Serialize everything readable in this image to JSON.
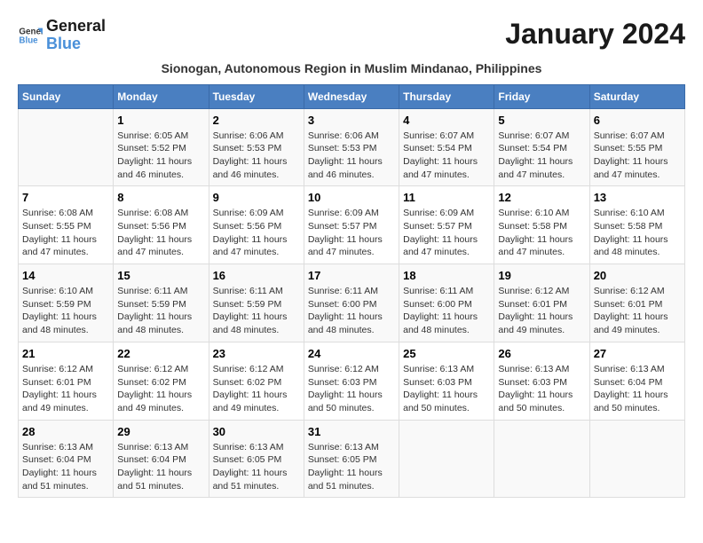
{
  "logo": {
    "line1": "General",
    "line2": "Blue"
  },
  "header": {
    "month": "January 2024",
    "subtitle": "Sionogan, Autonomous Region in Muslim Mindanao, Philippines"
  },
  "days_of_week": [
    "Sunday",
    "Monday",
    "Tuesday",
    "Wednesday",
    "Thursday",
    "Friday",
    "Saturday"
  ],
  "weeks": [
    [
      {
        "date": "",
        "info": ""
      },
      {
        "date": "1",
        "info": "Sunrise: 6:05 AM\nSunset: 5:52 PM\nDaylight: 11 hours\nand 46 minutes."
      },
      {
        "date": "2",
        "info": "Sunrise: 6:06 AM\nSunset: 5:53 PM\nDaylight: 11 hours\nand 46 minutes."
      },
      {
        "date": "3",
        "info": "Sunrise: 6:06 AM\nSunset: 5:53 PM\nDaylight: 11 hours\nand 46 minutes."
      },
      {
        "date": "4",
        "info": "Sunrise: 6:07 AM\nSunset: 5:54 PM\nDaylight: 11 hours\nand 47 minutes."
      },
      {
        "date": "5",
        "info": "Sunrise: 6:07 AM\nSunset: 5:54 PM\nDaylight: 11 hours\nand 47 minutes."
      },
      {
        "date": "6",
        "info": "Sunrise: 6:07 AM\nSunset: 5:55 PM\nDaylight: 11 hours\nand 47 minutes."
      }
    ],
    [
      {
        "date": "7",
        "info": "Sunrise: 6:08 AM\nSunset: 5:55 PM\nDaylight: 11 hours\nand 47 minutes."
      },
      {
        "date": "8",
        "info": "Sunrise: 6:08 AM\nSunset: 5:56 PM\nDaylight: 11 hours\nand 47 minutes."
      },
      {
        "date": "9",
        "info": "Sunrise: 6:09 AM\nSunset: 5:56 PM\nDaylight: 11 hours\nand 47 minutes."
      },
      {
        "date": "10",
        "info": "Sunrise: 6:09 AM\nSunset: 5:57 PM\nDaylight: 11 hours\nand 47 minutes."
      },
      {
        "date": "11",
        "info": "Sunrise: 6:09 AM\nSunset: 5:57 PM\nDaylight: 11 hours\nand 47 minutes."
      },
      {
        "date": "12",
        "info": "Sunrise: 6:10 AM\nSunset: 5:58 PM\nDaylight: 11 hours\nand 47 minutes."
      },
      {
        "date": "13",
        "info": "Sunrise: 6:10 AM\nSunset: 5:58 PM\nDaylight: 11 hours\nand 48 minutes."
      }
    ],
    [
      {
        "date": "14",
        "info": "Sunrise: 6:10 AM\nSunset: 5:59 PM\nDaylight: 11 hours\nand 48 minutes."
      },
      {
        "date": "15",
        "info": "Sunrise: 6:11 AM\nSunset: 5:59 PM\nDaylight: 11 hours\nand 48 minutes."
      },
      {
        "date": "16",
        "info": "Sunrise: 6:11 AM\nSunset: 5:59 PM\nDaylight: 11 hours\nand 48 minutes."
      },
      {
        "date": "17",
        "info": "Sunrise: 6:11 AM\nSunset: 6:00 PM\nDaylight: 11 hours\nand 48 minutes."
      },
      {
        "date": "18",
        "info": "Sunrise: 6:11 AM\nSunset: 6:00 PM\nDaylight: 11 hours\nand 48 minutes."
      },
      {
        "date": "19",
        "info": "Sunrise: 6:12 AM\nSunset: 6:01 PM\nDaylight: 11 hours\nand 49 minutes."
      },
      {
        "date": "20",
        "info": "Sunrise: 6:12 AM\nSunset: 6:01 PM\nDaylight: 11 hours\nand 49 minutes."
      }
    ],
    [
      {
        "date": "21",
        "info": "Sunrise: 6:12 AM\nSunset: 6:01 PM\nDaylight: 11 hours\nand 49 minutes."
      },
      {
        "date": "22",
        "info": "Sunrise: 6:12 AM\nSunset: 6:02 PM\nDaylight: 11 hours\nand 49 minutes."
      },
      {
        "date": "23",
        "info": "Sunrise: 6:12 AM\nSunset: 6:02 PM\nDaylight: 11 hours\nand 49 minutes."
      },
      {
        "date": "24",
        "info": "Sunrise: 6:12 AM\nSunset: 6:03 PM\nDaylight: 11 hours\nand 50 minutes."
      },
      {
        "date": "25",
        "info": "Sunrise: 6:13 AM\nSunset: 6:03 PM\nDaylight: 11 hours\nand 50 minutes."
      },
      {
        "date": "26",
        "info": "Sunrise: 6:13 AM\nSunset: 6:03 PM\nDaylight: 11 hours\nand 50 minutes."
      },
      {
        "date": "27",
        "info": "Sunrise: 6:13 AM\nSunset: 6:04 PM\nDaylight: 11 hours\nand 50 minutes."
      }
    ],
    [
      {
        "date": "28",
        "info": "Sunrise: 6:13 AM\nSunset: 6:04 PM\nDaylight: 11 hours\nand 51 minutes."
      },
      {
        "date": "29",
        "info": "Sunrise: 6:13 AM\nSunset: 6:04 PM\nDaylight: 11 hours\nand 51 minutes."
      },
      {
        "date": "30",
        "info": "Sunrise: 6:13 AM\nSunset: 6:05 PM\nDaylight: 11 hours\nand 51 minutes."
      },
      {
        "date": "31",
        "info": "Sunrise: 6:13 AM\nSunset: 6:05 PM\nDaylight: 11 hours\nand 51 minutes."
      },
      {
        "date": "",
        "info": ""
      },
      {
        "date": "",
        "info": ""
      },
      {
        "date": "",
        "info": ""
      }
    ]
  ]
}
